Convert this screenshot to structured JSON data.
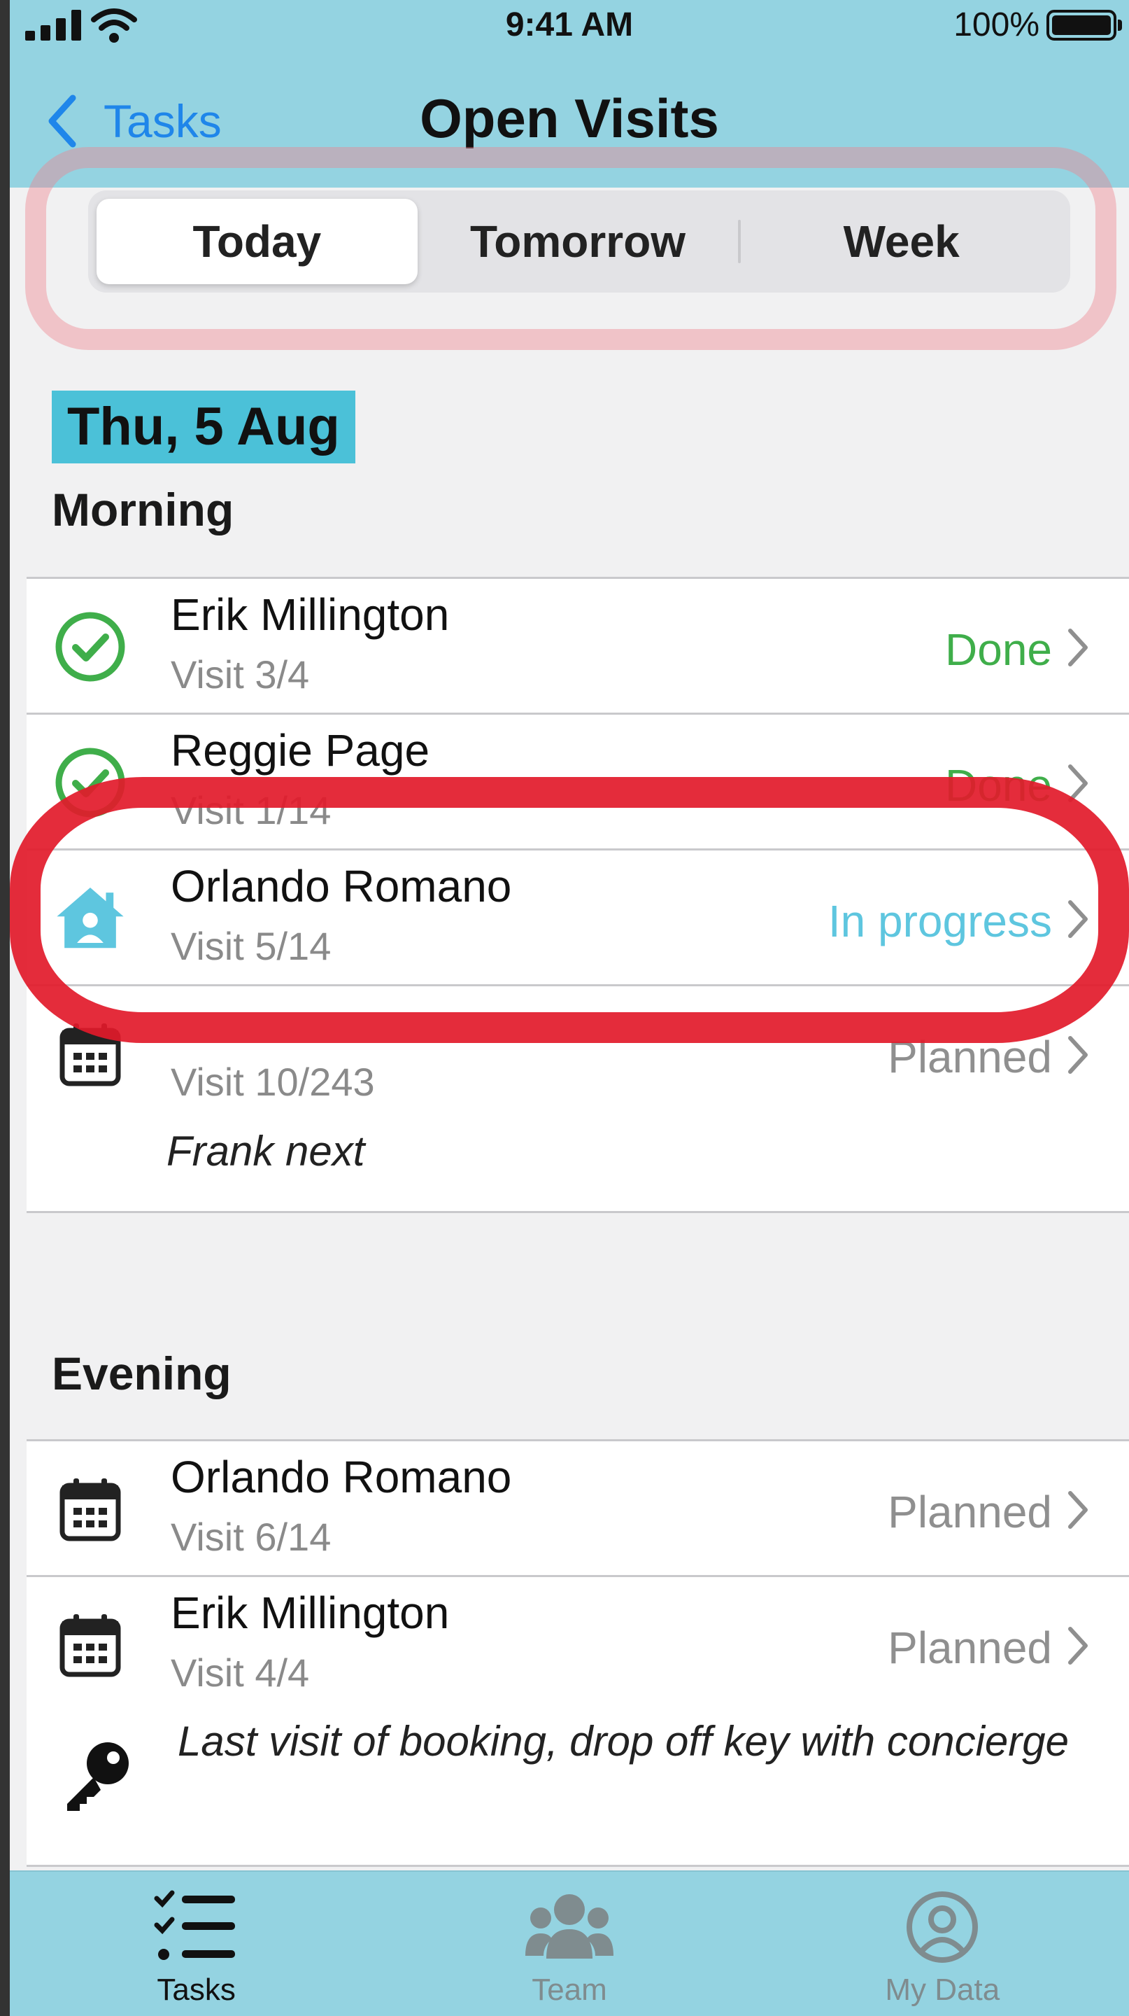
{
  "status_bar": {
    "time": "9:41 AM",
    "battery": "100%"
  },
  "nav": {
    "back_label": "Tasks",
    "title": "Open Visits"
  },
  "segments": [
    "Today",
    "Tomorrow",
    "Week"
  ],
  "date_label": "Thu, 5 Aug",
  "sections": {
    "morning": {
      "title": "Morning",
      "rows": [
        {
          "name": "Erik Millington",
          "visit": "Visit 3/4",
          "status": "Done",
          "icon": "check-circle-icon"
        },
        {
          "name": "Reggie Page",
          "visit": "Visit 1/14",
          "status": "Done",
          "icon": "check-circle-icon"
        },
        {
          "name": "Orlando Romano",
          "visit": "Visit 5/14",
          "status": "In progress",
          "icon": "house-icon"
        },
        {
          "name": "",
          "visit": "Visit 10/243",
          "status": "Planned",
          "icon": "calendar-icon",
          "note": "Frank next"
        }
      ]
    },
    "evening": {
      "title": "Evening",
      "rows": [
        {
          "name": "Orlando Romano",
          "visit": "Visit 6/14",
          "status": "Planned",
          "icon": "calendar-icon"
        },
        {
          "name": "Erik Millington",
          "visit": "Visit 4/4",
          "status": "Planned",
          "icon": "calendar-icon",
          "note": "Last visit of booking, drop off key with concierge",
          "note_icon": "key-icon"
        }
      ]
    }
  },
  "tabs": [
    "Tasks",
    "Team",
    "My Data"
  ],
  "colors": {
    "header_bg": "#94d3e1",
    "accent_blue": "#1f86ea",
    "done_green": "#3fae4a",
    "in_progress_blue": "#5ec6df",
    "planned_gray": "#8f8f8f",
    "date_chip": "#4bc1d8"
  }
}
